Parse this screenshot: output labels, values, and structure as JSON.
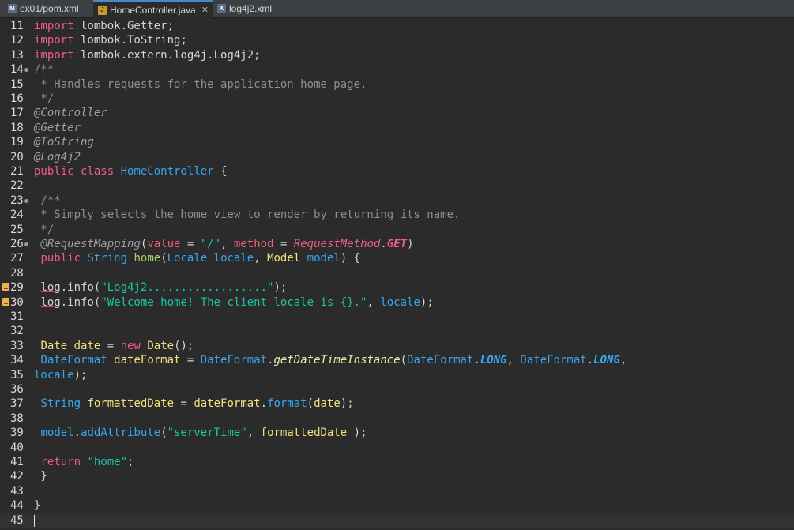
{
  "tabs": [
    {
      "label": "ex01/pom.xml",
      "icon": "xml-file-icon",
      "active": false
    },
    {
      "label": "HomeController.java",
      "icon": "java-file-icon",
      "active": true,
      "close": "✕"
    },
    {
      "label": "log4j2.xml",
      "icon": "xml-file-icon",
      "active": false
    }
  ],
  "lines": [
    {
      "n": "11",
      "html": "<span class='k'>import</span> lombok.Getter;"
    },
    {
      "n": "12",
      "html": "<span class='k'>import</span> lombok.ToString;"
    },
    {
      "n": "13",
      "html": "<span class='k'>import</span> lombok.extern.log4j.Log4j2;"
    },
    {
      "n": "14",
      "fold": true,
      "html": "<span class='c'>/**</span>"
    },
    {
      "n": "15",
      "html": "<span class='c'> * Handles requests for the application home page.</span>"
    },
    {
      "n": "16",
      "html": "<span class='c'> */</span>"
    },
    {
      "n": "17",
      "html": "<span class='a'>@Controller</span>"
    },
    {
      "n": "18",
      "html": "<span class='a'>@Getter</span>"
    },
    {
      "n": "19",
      "html": "<span class='a'>@ToString</span>"
    },
    {
      "n": "20",
      "html": "<span class='a'>@Log4j2</span>"
    },
    {
      "n": "21",
      "html": "<span class='k'>public class</span> <span class='t'>HomeController</span> {"
    },
    {
      "n": "22",
      "html": ""
    },
    {
      "n": "23",
      "fold": true,
      "html": " <span class='c'>/**</span>"
    },
    {
      "n": "24",
      "html": "<span class='c'> * Simply selects the home view to render by returning its name.</span>"
    },
    {
      "n": "25",
      "html": "<span class='c'> */</span>"
    },
    {
      "n": "26",
      "fold": true,
      "html": " <span class='a'>@RequestMapping</span>(<span class='k'>value</span> = <span class='s'>\"/\"</span>, <span class='k'>method</span> = <span class='a' style='color:#f35c87'>RequestMethod</span>.<span class='cst' style='color:#f35c87'>GET</span>)"
    },
    {
      "n": "27",
      "html": " <span class='k'>public</span> <span class='t'>String</span> <span class='m'>home</span>(<span class='t'>Locale</span> <span class='t'>locale</span>, <span class='f'>Model</span> <span class='t'>model</span>) {"
    },
    {
      "n": "28",
      "html": ""
    },
    {
      "n": "29",
      "warn": true,
      "html": " <span class='uline'>log</span>.info(<span class='s'>\"Log4j2..................\"</span>);"
    },
    {
      "n": "30",
      "warn": true,
      "html": " <span class='uline'>log</span>.info(<span class='s'>\"Welcome home! The client locale is {}.\"</span>, <span class='t'>locale</span>);"
    },
    {
      "n": "31",
      "html": ""
    },
    {
      "n": "32",
      "html": ""
    },
    {
      "n": "33",
      "html": " <span class='f'>Date</span> <span class='f'>date</span> = <span class='k'>new</span> <span class='f'>Date</span>();"
    },
    {
      "n": "34",
      "html": " <span class='t'>DateFormat</span> <span class='f'>dateFormat</span> = <span class='t'>DateFormat</span>.<span class='ic'>getDateTimeInstance</span>(<span class='t'>DateFormat</span>.<span class='cst'>LONG</span>, <span class='t'>DateFormat</span>.<span class='cst'>LONG</span>,"
    },
    {
      "n": "35",
      "html": "<span class='t'>locale</span>);"
    },
    {
      "n": "36",
      "html": ""
    },
    {
      "n": "37",
      "html": " <span class='t'>String</span> <span class='f'>formattedDate</span> = <span class='f'>dateFormat</span>.<span class='t'>format</span>(<span class='f'>date</span>);"
    },
    {
      "n": "38",
      "html": ""
    },
    {
      "n": "39",
      "html": " <span class='t'>model</span>.<span class='t'>addAttribute</span>(<span class='s'>\"serverTime\"</span>, <span class='f'>formattedDate</span> );"
    },
    {
      "n": "40",
      "html": ""
    },
    {
      "n": "41",
      "html": " <span class='k'>return</span> <span class='s'>\"home\"</span>;"
    },
    {
      "n": "42",
      "html": " }"
    },
    {
      "n": "43",
      "html": ""
    },
    {
      "n": "44",
      "html": "}"
    },
    {
      "n": "45",
      "cursor": true,
      "html": ""
    }
  ]
}
